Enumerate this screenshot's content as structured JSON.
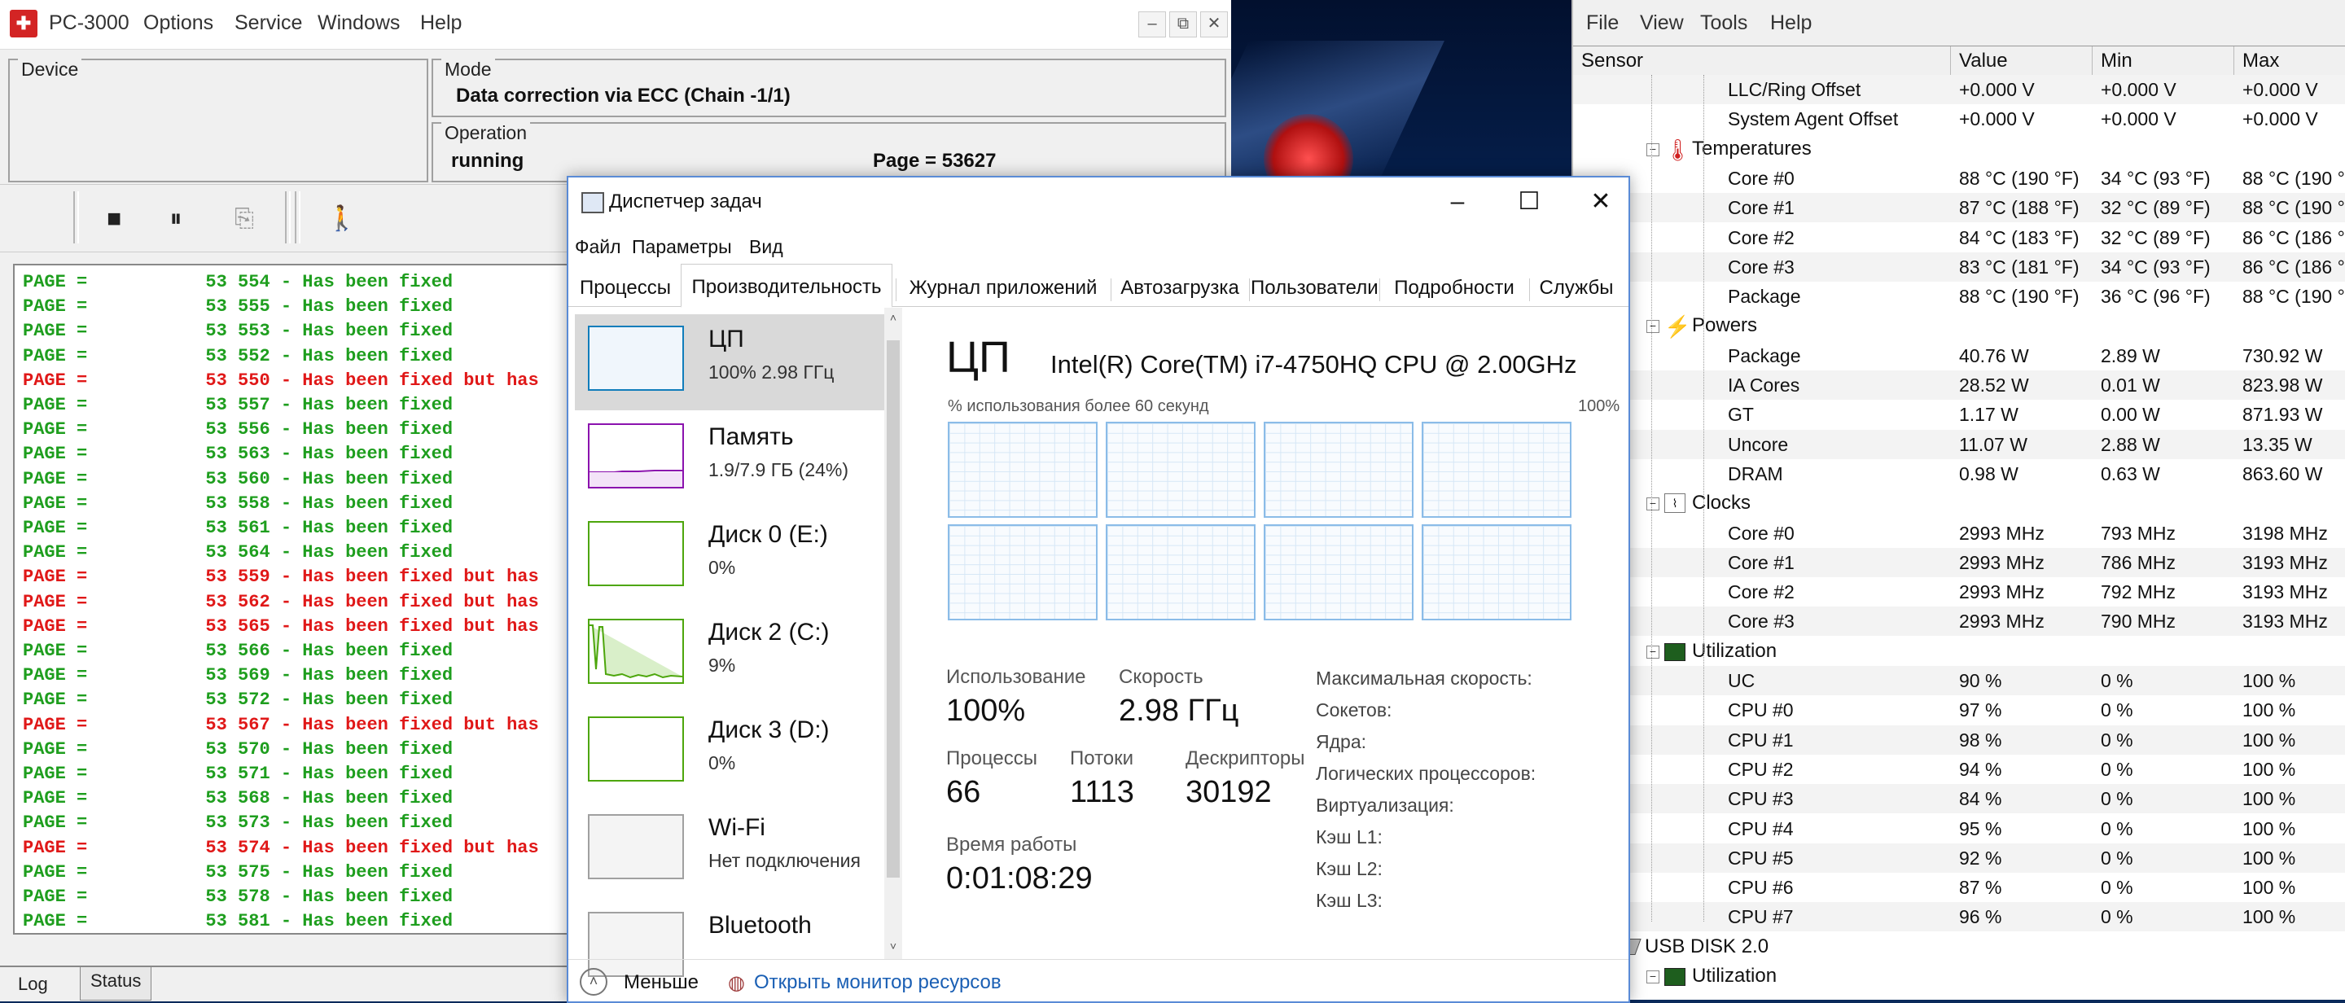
{
  "pc3000": {
    "title": "PC-3000",
    "menu": [
      "Options",
      "Service",
      "Windows",
      "Help"
    ],
    "window_controls": [
      "–",
      "⧉",
      "✕"
    ],
    "device_label": "Device",
    "mode_label": "Mode",
    "mode_value": "Data correction via ECC (Chain -1/1)",
    "operation_label": "Operation",
    "operation_status": "running",
    "operation_page": "Page = 53627",
    "log": [
      {
        "text": "PAGE =           53 554 - Has been fixed",
        "status": "green"
      },
      {
        "text": "PAGE =           53 555 - Has been fixed",
        "status": "green"
      },
      {
        "text": "PAGE =           53 553 - Has been fixed",
        "status": "green"
      },
      {
        "text": "PAGE =           53 552 - Has been fixed",
        "status": "green"
      },
      {
        "text": "PAGE =           53 550 - Has been fixed but has",
        "status": "red"
      },
      {
        "text": "PAGE =           53 557 - Has been fixed",
        "status": "green"
      },
      {
        "text": "PAGE =           53 556 - Has been fixed",
        "status": "green"
      },
      {
        "text": "PAGE =           53 563 - Has been fixed",
        "status": "green"
      },
      {
        "text": "PAGE =           53 560 - Has been fixed",
        "status": "green"
      },
      {
        "text": "PAGE =           53 558 - Has been fixed",
        "status": "green"
      },
      {
        "text": "PAGE =           53 561 - Has been fixed",
        "status": "green"
      },
      {
        "text": "PAGE =           53 564 - Has been fixed",
        "status": "green"
      },
      {
        "text": "PAGE =           53 559 - Has been fixed but has",
        "status": "red"
      },
      {
        "text": "PAGE =           53 562 - Has been fixed but has",
        "status": "red"
      },
      {
        "text": "PAGE =           53 565 - Has been fixed but has",
        "status": "red"
      },
      {
        "text": "PAGE =           53 566 - Has been fixed",
        "status": "green"
      },
      {
        "text": "PAGE =           53 569 - Has been fixed",
        "status": "green"
      },
      {
        "text": "PAGE =           53 572 - Has been fixed",
        "status": "green"
      },
      {
        "text": "PAGE =           53 567 - Has been fixed but has",
        "status": "red"
      },
      {
        "text": "PAGE =           53 570 - Has been fixed",
        "status": "green"
      },
      {
        "text": "PAGE =           53 571 - Has been fixed",
        "status": "green"
      },
      {
        "text": "PAGE =           53 568 - Has been fixed",
        "status": "green"
      },
      {
        "text": "PAGE =           53 573 - Has been fixed",
        "status": "green"
      },
      {
        "text": "PAGE =           53 574 - Has been fixed but has",
        "status": "red"
      },
      {
        "text": "PAGE =           53 575 - Has been fixed",
        "status": "green"
      },
      {
        "text": "PAGE =           53 578 - Has been fixed",
        "status": "green"
      },
      {
        "text": "PAGE =           53 581 - Has been fixed",
        "status": "green"
      }
    ],
    "tabs": [
      "Log",
      "Status"
    ],
    "colors": {
      "green": "#1e9e1e",
      "red": "#e01818"
    }
  },
  "taskmgr": {
    "title": "Диспетчер задач",
    "menu": [
      "Файл",
      "Параметры",
      "Вид"
    ],
    "tabs": [
      "Процессы",
      "Производительность",
      "Журнал приложений",
      "Автозагрузка",
      "Пользователи",
      "Подробности",
      "Службы"
    ],
    "active_tab": 1,
    "sidebar": [
      {
        "name": "ЦП",
        "sub": "100%  2.98 ГГц",
        "color": "#117dbb"
      },
      {
        "name": "Память",
        "sub": "1.9/7.9 ГБ (24%)",
        "color": "#8b12ae"
      },
      {
        "name": "Диск 0 (E:)",
        "sub": "0%",
        "color": "#4da60c"
      },
      {
        "name": "Диск 2 (C:)",
        "sub": "9%",
        "color": "#4da60c"
      },
      {
        "name": "Диск 3 (D:)",
        "sub": "0%",
        "color": "#4da60c"
      },
      {
        "name": "Wi-Fi",
        "sub": "Нет подключения",
        "color": "#a0a0a0"
      },
      {
        "name": "Bluetooth",
        "sub": "",
        "color": "#a0a0a0"
      }
    ],
    "cpu": {
      "heading": "ЦП",
      "model": "Intel(R) Core(TM) i7-4750HQ CPU @ 2.00GHz",
      "graph_caption": "% использования более 60 секунд",
      "graph_max": "100%",
      "usage_label": "Использование",
      "usage_value": "100%",
      "speed_label": "Скорость",
      "speed_value": "2.98 ГГц",
      "proc_label": "Процессы",
      "proc_value": "66",
      "threads_label": "Потоки",
      "threads_value": "1113",
      "handles_label": "Дескрипторы",
      "handles_value": "30192",
      "uptime_label": "Время работы",
      "uptime_value": "0:01:08:29",
      "specs": [
        "Максимальная скорость:",
        "Сокетов:",
        "Ядра:",
        "Логических процессоров:",
        "Виртуализация:",
        "Кэш L1:",
        "Кэш L2:",
        "Кэш L3:"
      ]
    },
    "footer": {
      "less": "Меньше",
      "monitor": "Открыть монитор ресурсов"
    }
  },
  "hwinfo": {
    "menu": [
      "File",
      "View",
      "Tools",
      "Help"
    ],
    "columns": [
      "Sensor",
      "Value",
      "Min",
      "Max"
    ],
    "rows": [
      {
        "type": "item",
        "name": "LLC/Ring Offset",
        "value": "+0.000 V",
        "min": "+0.000 V",
        "max": "+0.000 V"
      },
      {
        "type": "item",
        "name": "System Agent Offset",
        "value": "+0.000 V",
        "min": "+0.000 V",
        "max": "+0.000 V"
      },
      {
        "type": "group",
        "name": "Temperatures",
        "icon": "thermometer-icon"
      },
      {
        "type": "item",
        "name": "Core #0",
        "value": "88 °C  (190 °F)",
        "min": "34 °C  (93 °F)",
        "max": "88 °C  (190 °"
      },
      {
        "type": "item",
        "name": "Core #1",
        "value": "87 °C  (188 °F)",
        "min": "32 °C  (89 °F)",
        "max": "88 °C  (190 °"
      },
      {
        "type": "item",
        "name": "Core #2",
        "value": "84 °C  (183 °F)",
        "min": "32 °C  (89 °F)",
        "max": "86 °C  (186 °"
      },
      {
        "type": "item",
        "name": "Core #3",
        "value": "83 °C  (181 °F)",
        "min": "34 °C  (93 °F)",
        "max": "86 °C  (186 °"
      },
      {
        "type": "item",
        "name": "Package",
        "value": "88 °C  (190 °F)",
        "min": "36 °C  (96 °F)",
        "max": "88 °C  (190 °"
      },
      {
        "type": "group",
        "name": "Powers",
        "icon": "power-icon"
      },
      {
        "type": "item",
        "name": "Package",
        "value": "40.76 W",
        "min": "2.89 W",
        "max": "730.92 W"
      },
      {
        "type": "item",
        "name": "IA Cores",
        "value": "28.52 W",
        "min": "0.01 W",
        "max": "823.98 W"
      },
      {
        "type": "item",
        "name": "GT",
        "value": "1.17 W",
        "min": "0.00 W",
        "max": "871.93 W"
      },
      {
        "type": "item",
        "name": "Uncore",
        "value": "11.07 W",
        "min": "2.88 W",
        "max": "13.35 W"
      },
      {
        "type": "item",
        "name": "DRAM",
        "value": "0.98 W",
        "min": "0.63 W",
        "max": "863.60 W"
      },
      {
        "type": "group",
        "name": "Clocks",
        "icon": "clock-icon"
      },
      {
        "type": "item",
        "name": "Core #0",
        "value": "2993 MHz",
        "min": "793 MHz",
        "max": "3198 MHz"
      },
      {
        "type": "item",
        "name": "Core #1",
        "value": "2993 MHz",
        "min": "786 MHz",
        "max": "3193 MHz"
      },
      {
        "type": "item",
        "name": "Core #2",
        "value": "2993 MHz",
        "min": "792 MHz",
        "max": "3193 MHz"
      },
      {
        "type": "item",
        "name": "Core #3",
        "value": "2993 MHz",
        "min": "790 MHz",
        "max": "3193 MHz"
      },
      {
        "type": "group",
        "name": "Utilization",
        "icon": "utilization-icon"
      },
      {
        "type": "item",
        "name": "UC",
        "value": "90 %",
        "min": "0 %",
        "max": "100 %"
      },
      {
        "type": "item",
        "name": "CPU #0",
        "value": "97 %",
        "min": "0 %",
        "max": "100 %"
      },
      {
        "type": "item",
        "name": "CPU #1",
        "value": "98 %",
        "min": "0 %",
        "max": "100 %"
      },
      {
        "type": "item",
        "name": "CPU #2",
        "value": "94 %",
        "min": "0 %",
        "max": "100 %"
      },
      {
        "type": "item",
        "name": "CPU #3",
        "value": "84 %",
        "min": "0 %",
        "max": "100 %"
      },
      {
        "type": "item",
        "name": "CPU #4",
        "value": "95 %",
        "min": "0 %",
        "max": "100 %"
      },
      {
        "type": "item",
        "name": "CPU #5",
        "value": "92 %",
        "min": "0 %",
        "max": "100 %"
      },
      {
        "type": "item",
        "name": "CPU #6",
        "value": "87 %",
        "min": "0 %",
        "max": "100 %"
      },
      {
        "type": "item",
        "name": "CPU #7",
        "value": "96 %",
        "min": "0 %",
        "max": "100 %"
      },
      {
        "type": "device",
        "name": "USB DISK 2.0",
        "icon": "disk-icon"
      },
      {
        "type": "group",
        "name": "Utilization",
        "icon": "utilization-icon"
      }
    ]
  }
}
